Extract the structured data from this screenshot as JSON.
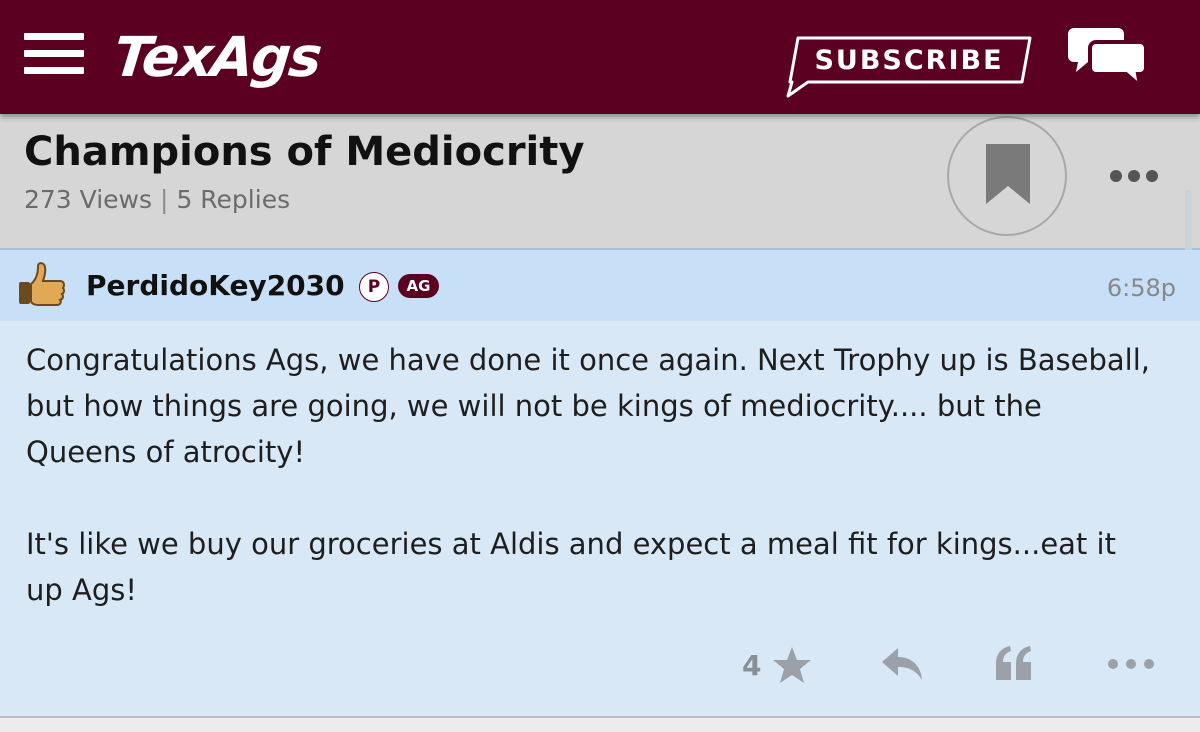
{
  "header": {
    "logo_text": "TexAgs",
    "subscribe_label": "SUBSCRIBE",
    "brand_color": "#5c0021",
    "icons": [
      "menu-icon",
      "chat-bubbles-icon"
    ]
  },
  "thread": {
    "title": "Champions of Mediocrity",
    "views": "273 Views",
    "separator": "|",
    "replies": "5 Replies",
    "icons": [
      "bookmark-icon",
      "more-options-icon"
    ]
  },
  "post": {
    "username": "PerdidoKey2030",
    "badge_p": "P",
    "badge_ag": "AG",
    "time": "6:58p",
    "paragraphs": [
      "Congratulations Ags, we have done it once again. Next Trophy up is Baseball, but how things are going, we will not be kings of mediocrity.... but the Queens of atrocity!",
      "It's like we buy our groceries at Aldis and expect a meal fit for kings...eat it up Ags!"
    ],
    "rating_count": "4",
    "icons": [
      "thumbs-up-avatar-icon",
      "star-icon",
      "reply-icon",
      "quote-icon",
      "more-options-icon"
    ]
  }
}
